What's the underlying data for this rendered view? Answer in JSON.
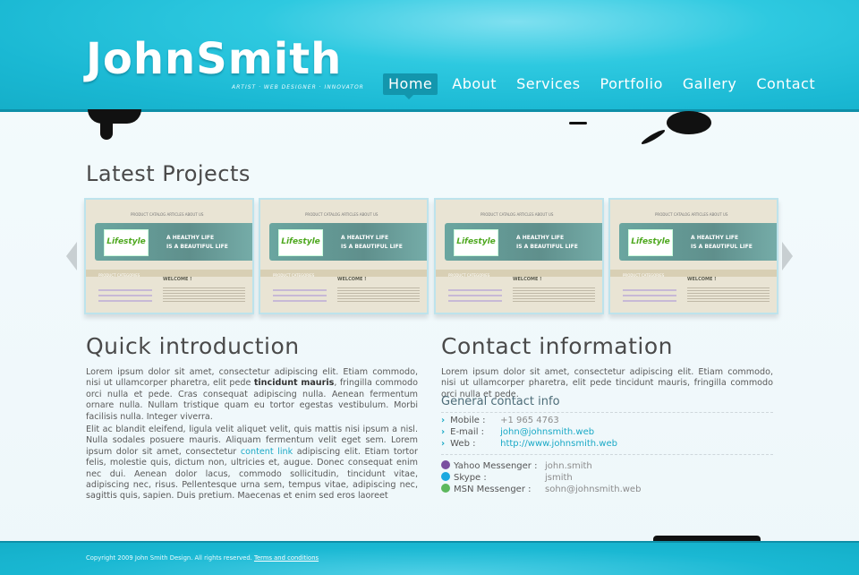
{
  "brand": {
    "name": "JohnSmith",
    "tagline": "ARTIST · WEB DESIGNER · INNOVATOR"
  },
  "nav": {
    "items": [
      "Home",
      "About",
      "Services",
      "Portfolio",
      "Gallery",
      "Contact"
    ],
    "active": "Home"
  },
  "projects": {
    "title": "Latest Projects",
    "items": [
      {
        "badge": "Lifestyle",
        "headline1": "A HEALTHY LIFE",
        "headline2": "IS A BEAUTIFUL LIFE",
        "welcome": "WELCOME !",
        "categories": "PRODUCT CATEGORIES",
        "topnav": "PRODUCT CATALOG   ARTICLES   ABOUT US"
      },
      {
        "badge": "Lifestyle",
        "headline1": "A HEALTHY LIFE",
        "headline2": "IS A BEAUTIFUL LIFE",
        "welcome": "WELCOME !",
        "categories": "PRODUCT CATEGORIES",
        "topnav": "PRODUCT CATALOG   ARTICLES   ABOUT US"
      },
      {
        "badge": "Lifestyle",
        "headline1": "A HEALTHY LIFE",
        "headline2": "IS A BEAUTIFUL LIFE",
        "welcome": "WELCOME !",
        "categories": "PRODUCT CATEGORIES",
        "topnav": "PRODUCT CATALOG   ARTICLES   ABOUT US"
      },
      {
        "badge": "Lifestyle",
        "headline1": "A HEALTHY LIFE",
        "headline2": "IS A BEAUTIFUL LIFE",
        "welcome": "WELCOME !",
        "categories": "PRODUCT CATEGORIES",
        "topnav": "PRODUCT CATALOG   ARTICLES   ABOUT US"
      }
    ]
  },
  "intro": {
    "title": "Quick introduction",
    "p1_a": "Lorem ipsum dolor sit amet, consectetur adipiscing elit. Etiam commodo, nisi ut ullamcorper pharetra, elit pede ",
    "p1_bold": "tincidunt mauris",
    "p1_b": ", fringilla commodo orci nulla et pede. Cras consequat adipiscing nulla. Aenean fermentum ornare nulla. Nullam tristique quam eu tortor egestas vestibulum. Morbi facilisis nulla. Integer viverra.",
    "p2_a": "Elit ac blandit eleifend, ligula velit aliquet velit, quis mattis nisi ipsum a nisl. Nulla sodales posuere mauris. Aliquam fermentum velit eget sem. Lorem ipsum dolor sit amet, consectetur ",
    "p2_link": "content link",
    "p2_b": " adipiscing elit. Etiam tortor felis, molestie quis, dictum non, ultricies et, augue. Donec consequat enim nec dui. Aenean dolor lacus, commodo sollicitudin, tincidunt vitae, adipiscing nec, risus. Pellentesque urna sem, tempus vitae, adipiscing nec, sagittis quis, sapien. Duis pretium. Maecenas et enim sed eros laoreet"
  },
  "contact": {
    "title": "Contact information",
    "text": "Lorem ipsum dolor sit amet, consectetur adipiscing elit. Etiam commodo, nisi ut ullamcorper pharetra, elit pede tincidunt mauris, fringilla commodo orci nulla et pede.",
    "general_title": "General contact info",
    "mobile_label": "Mobile :",
    "mobile": "+1 965 4763",
    "email_label": "E-mail :",
    "email": "john@johnsmith.web",
    "web_label": "Web :",
    "web": "http://www.johnsmith.web",
    "yahoo_label": "Yahoo Messenger :",
    "yahoo": "john.smith",
    "skype_label": "Skype :",
    "skype": "jsmith",
    "msn_label": "MSN Messenger :",
    "msn": "sohn@johnsmith.web"
  },
  "footer": {
    "copyright": "Copyright 2009 John Smith Design. All rights reserved.",
    "terms": "Terms and conditions"
  },
  "colors": {
    "accent": "#1ab8d3",
    "link": "#1aa9c6",
    "heading": "#4a4a4a"
  }
}
